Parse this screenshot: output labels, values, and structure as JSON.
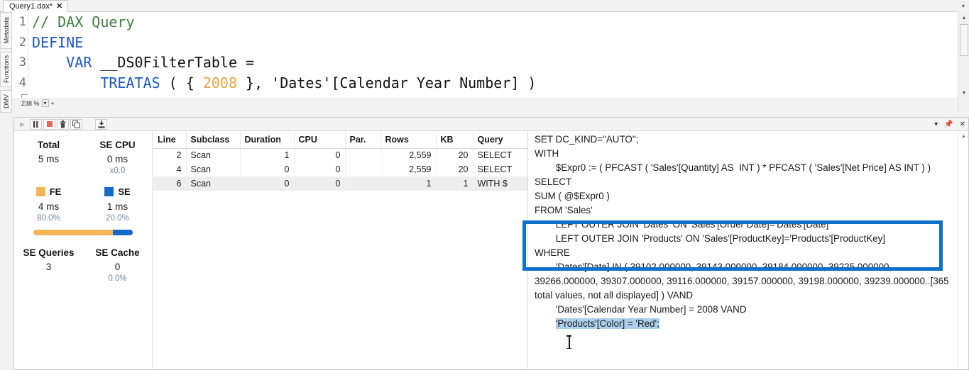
{
  "window": {
    "tab": {
      "label": "Query1.dax*",
      "close_icon": "close-icon"
    },
    "side_tabs": [
      "Metadata",
      "Functions",
      "DMV"
    ]
  },
  "editor": {
    "zoom_level": "238 %",
    "lines": [
      {
        "num": "1",
        "tokens": [
          {
            "t": "// DAX Query",
            "c": "comment"
          }
        ]
      },
      {
        "num": "2",
        "tokens": [
          {
            "t": "DEFINE",
            "c": "key"
          }
        ]
      },
      {
        "num": "3",
        "tokens": [
          {
            "t": "    ",
            "c": "id"
          },
          {
            "t": "VAR",
            "c": "key"
          },
          {
            "t": " __DS0FilterTable =",
            "c": "id"
          }
        ]
      },
      {
        "num": "4",
        "tokens": [
          {
            "t": "        ",
            "c": "id"
          },
          {
            "t": "TREATAS",
            "c": "key"
          },
          {
            "t": " ( { ",
            "c": "id"
          },
          {
            "t": "2008",
            "c": "num"
          },
          {
            "t": " }, 'Dates'[Calendar Year Number] )",
            "c": "id"
          }
        ]
      }
    ]
  },
  "toolbar": {
    "buttons": [
      {
        "name": "run-button",
        "glyph": "▶",
        "state": "disabled"
      },
      {
        "name": "pause-button",
        "glyph": "❙❙",
        "state": "framed"
      },
      {
        "name": "stop-button",
        "glyph": "■",
        "state": "framed-red"
      },
      {
        "name": "clear-button",
        "glyph": "🗑",
        "state": "framed"
      },
      {
        "name": "copy-button",
        "glyph": "⧉",
        "state": "framed"
      },
      {
        "name": "export-button",
        "glyph": "⤓",
        "state": "framed"
      }
    ],
    "window_controls": [
      {
        "name": "dropdown-icon",
        "glyph": "▾"
      },
      {
        "name": "pin-icon",
        "glyph": "📌"
      },
      {
        "name": "close-icon",
        "glyph": "✕"
      }
    ]
  },
  "metrics": {
    "total": {
      "label": "Total",
      "value": "5 ms"
    },
    "se_cpu": {
      "label": "SE CPU",
      "value": "0 ms",
      "sub": "x0.0"
    },
    "fe": {
      "label": "FE",
      "value": "4 ms",
      "percent": "80.0%",
      "color": "#f5b556",
      "share": 80
    },
    "se": {
      "label": "SE",
      "value": "1 ms",
      "percent": "20.0%",
      "color": "#1569c7",
      "share": 20
    },
    "se_queries": {
      "label": "SE Queries",
      "value": "3"
    },
    "se_cache": {
      "label": "SE Cache",
      "value": "0",
      "sub": "0.0%"
    }
  },
  "grid": {
    "columns": [
      "Line",
      "Subclass",
      "Duration",
      "CPU",
      "Par.",
      "Rows",
      "KB",
      "Query"
    ],
    "rows": [
      {
        "line": "2",
        "subclass": "Scan",
        "duration": "1",
        "cpu": "0",
        "par": "",
        "rows": "2,559",
        "kb": "20",
        "query": "SELECT",
        "selected": false
      },
      {
        "line": "4",
        "subclass": "Scan",
        "duration": "0",
        "cpu": "0",
        "par": "",
        "rows": "2,559",
        "kb": "20",
        "query": "SELECT",
        "selected": false
      },
      {
        "line": "6",
        "subclass": "Scan",
        "duration": "0",
        "cpu": "0",
        "par": "",
        "rows": "1",
        "kb": "1",
        "query": "WITH $",
        "selected": true
      }
    ]
  },
  "sql": {
    "before_selection": "SET DC_KIND=\"AUTO\";\nWITH\n        $Expr0 := ( PFCAST ( 'Sales'[Quantity] AS  INT ) * PFCAST ( 'Sales'[Net Price] AS INT ) )\nSELECT\nSUM ( @$Expr0 )\nFROM 'Sales'\n        LEFT OUTER JOIN 'Dates' ON 'Sales'[Order Date]='Dates'[Date]\n        LEFT OUTER JOIN 'Products' ON 'Sales'[ProductKey]='Products'[ProductKey]\nWHERE\n        'Dates'[Date] IN ( 39102.000000, 39143.000000, 39184.000000, 39225.000000, 39266.000000, 39307.000000, 39116.000000, 39157.000000, 39198.000000, 39239.000000..[365 total values, not all displayed] ) VAND\n        'Dates'[Calendar Year Number] = 2008 VAND\n        ",
    "selected_text": "'Products'[Color] = 'Red';",
    "selection_color": "#add0ec",
    "scroll_up_icon": "▲"
  },
  "annotation": {
    "color": "#0f72c8"
  }
}
